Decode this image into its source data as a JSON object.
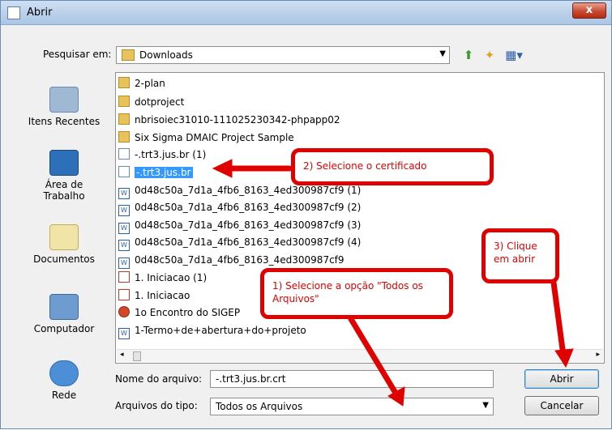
{
  "title": "Abrir",
  "close": "x",
  "lookin": {
    "label": "Pesquisar em:",
    "value": "Downloads"
  },
  "places": [
    "Itens Recentes",
    "Área de Trabalho",
    "Documentos",
    "Computador",
    "Rede"
  ],
  "files": [
    {
      "name": "2-plan",
      "icon": "folder-icon"
    },
    {
      "name": "dotproject",
      "icon": "folder-icon"
    },
    {
      "name": "nbrisoiec31010-111025230342-phpapp02",
      "icon": "folder-icon"
    },
    {
      "name": "Six Sigma DMAIC Project Sample",
      "icon": "folder-icon"
    },
    {
      "name": "-.trt3.jus.br (1)",
      "icon": "certificate-icon"
    },
    {
      "name": "-.trt3.jus.br",
      "icon": "certificate-icon",
      "selected": true
    },
    {
      "name": "0d48c50a_7d1a_4fb6_8163_4ed300987cf9 (1)",
      "icon": "word-doc-icon"
    },
    {
      "name": "0d48c50a_7d1a_4fb6_8163_4ed300987cf9 (2)",
      "icon": "word-doc-icon"
    },
    {
      "name": "0d48c50a_7d1a_4fb6_8163_4ed300987cf9 (3)",
      "icon": "word-doc-icon"
    },
    {
      "name": "0d48c50a_7d1a_4fb6_8163_4ed300987cf9 (4)",
      "icon": "word-doc-icon"
    },
    {
      "name": "0d48c50a_7d1a_4fb6_8163_4ed300987cf9",
      "icon": "word-doc-icon"
    },
    {
      "name": "1. Iniciacao (1)",
      "icon": "pdf-icon"
    },
    {
      "name": "1. Iniciacao",
      "icon": "pdf-icon"
    },
    {
      "name": "1o Encontro do SIGEP",
      "icon": "powerpoint-icon"
    },
    {
      "name": "1-Termo+de+abertura+do+projeto",
      "icon": "word-doc-icon"
    }
  ],
  "filename": {
    "label": "Nome do arquivo:",
    "value": "-.trt3.jus.br.crt"
  },
  "filetype": {
    "label": "Arquivos do tipo:",
    "value": "Todos os Arquivos"
  },
  "buttons": {
    "open": "Abrir",
    "cancel": "Cancelar"
  },
  "callouts": {
    "select_cert": "2) Selecione o certificado",
    "click_open": "3) Clique em abrir",
    "select_all_files": "1) Selecione a opção \"Todos os Arquivos\""
  },
  "colors": {
    "annotation": "#e00000",
    "selection": "#3399ff"
  }
}
